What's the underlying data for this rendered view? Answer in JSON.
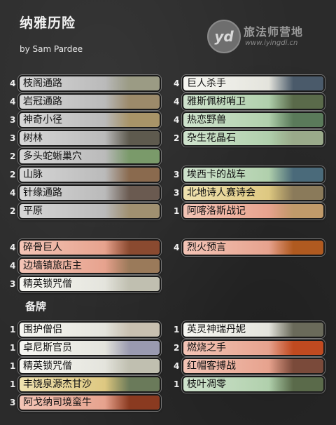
{
  "header": {
    "title": "纳雅历险",
    "byline": "by Sam Pardee",
    "logo_mark": "yd",
    "logo_name": "旅法师营地",
    "logo_url": "www.iyingdi.cn"
  },
  "main_left": [
    {
      "count": "4",
      "name": "枝阁通路",
      "color": "gray",
      "art": "#9b9b84"
    },
    {
      "count": "4",
      "name": "岩冠通路",
      "color": "gray",
      "art": "#9c8a6a"
    },
    {
      "count": "3",
      "name": "神奇小径",
      "color": "gray",
      "art": "#a89468"
    },
    {
      "count": "3",
      "name": "树林",
      "color": "gray",
      "art": "#5e5a4e"
    },
    {
      "count": "2",
      "name": "多头蛇蜥巢穴",
      "color": "gray",
      "art": "#7a9a6a"
    },
    {
      "count": "2",
      "name": "山脉",
      "color": "gray",
      "art": "#8a6a4e"
    },
    {
      "count": "4",
      "name": "针缘通路",
      "color": "gray",
      "art": "#6a5a50"
    },
    {
      "count": "2",
      "name": "平原",
      "color": "gray",
      "art": "#a09070"
    }
  ],
  "creatures_left": [
    {
      "count": "4",
      "name": "碎骨巨人",
      "color": "red",
      "art": "#8a4a30"
    },
    {
      "count": "4",
      "name": "边墙镇旅店主",
      "color": "red",
      "art": "#9a7a5a"
    },
    {
      "count": "3",
      "name": "精英锁咒僧",
      "color": "white",
      "art": "#c0bfb0"
    }
  ],
  "main_right": [
    {
      "count": "4",
      "name": "巨人杀手",
      "color": "white",
      "art": "#4a5a6a"
    },
    {
      "count": "4",
      "name": "雅斯佩树哨卫",
      "color": "green",
      "art": "#5a6a4a"
    },
    {
      "count": "4",
      "name": "热恋野兽",
      "color": "green",
      "art": "#5a7a5a"
    },
    {
      "count": "2",
      "name": "杂生花晶石",
      "color": "green",
      "art": "#9aaa8a"
    },
    {
      "count": "3",
      "name": "埃西卡的战车",
      "color": "green",
      "art": "#4a6a7a"
    },
    {
      "count": "3",
      "name": "北地诗人赛诗会",
      "color": "gold",
      "art": "#8a7a5a"
    },
    {
      "count": "1",
      "name": "阿喀洛斯战记",
      "color": "red",
      "art": "#c09a6a"
    },
    {
      "count": "4",
      "name": "烈火预言",
      "color": "red",
      "art": "#b05a20"
    }
  ],
  "sideboard": {
    "title": "备牌",
    "left": [
      {
        "count": "1",
        "name": "围护僧侣",
        "color": "white",
        "art": "#c8c0b0"
      },
      {
        "count": "1",
        "name": "卓尼斯官员",
        "color": "white",
        "art": "#9a9ab0"
      },
      {
        "count": "1",
        "name": "精英锁咒僧",
        "color": "white",
        "art": "#c0bfb0"
      },
      {
        "count": "1",
        "name": "丰饶泉源杰甘沙",
        "color": "gold",
        "art": "#6a7a5a"
      },
      {
        "count": "3",
        "name": "阿戈纳司境蛮牛",
        "color": "red",
        "art": "#8a3a20"
      }
    ],
    "right": [
      {
        "count": "1",
        "name": "英灵神瑞丹妮",
        "color": "white",
        "art": "#6a6a5a"
      },
      {
        "count": "2",
        "name": "燃烧之手",
        "color": "red",
        "art": "#c04a20"
      },
      {
        "count": "4",
        "name": "红帽客搏战",
        "color": "red",
        "art": "#7a4a3a"
      },
      {
        "count": "1",
        "name": "枝叶凋零",
        "color": "green",
        "art": "#5a6a4a"
      }
    ]
  }
}
